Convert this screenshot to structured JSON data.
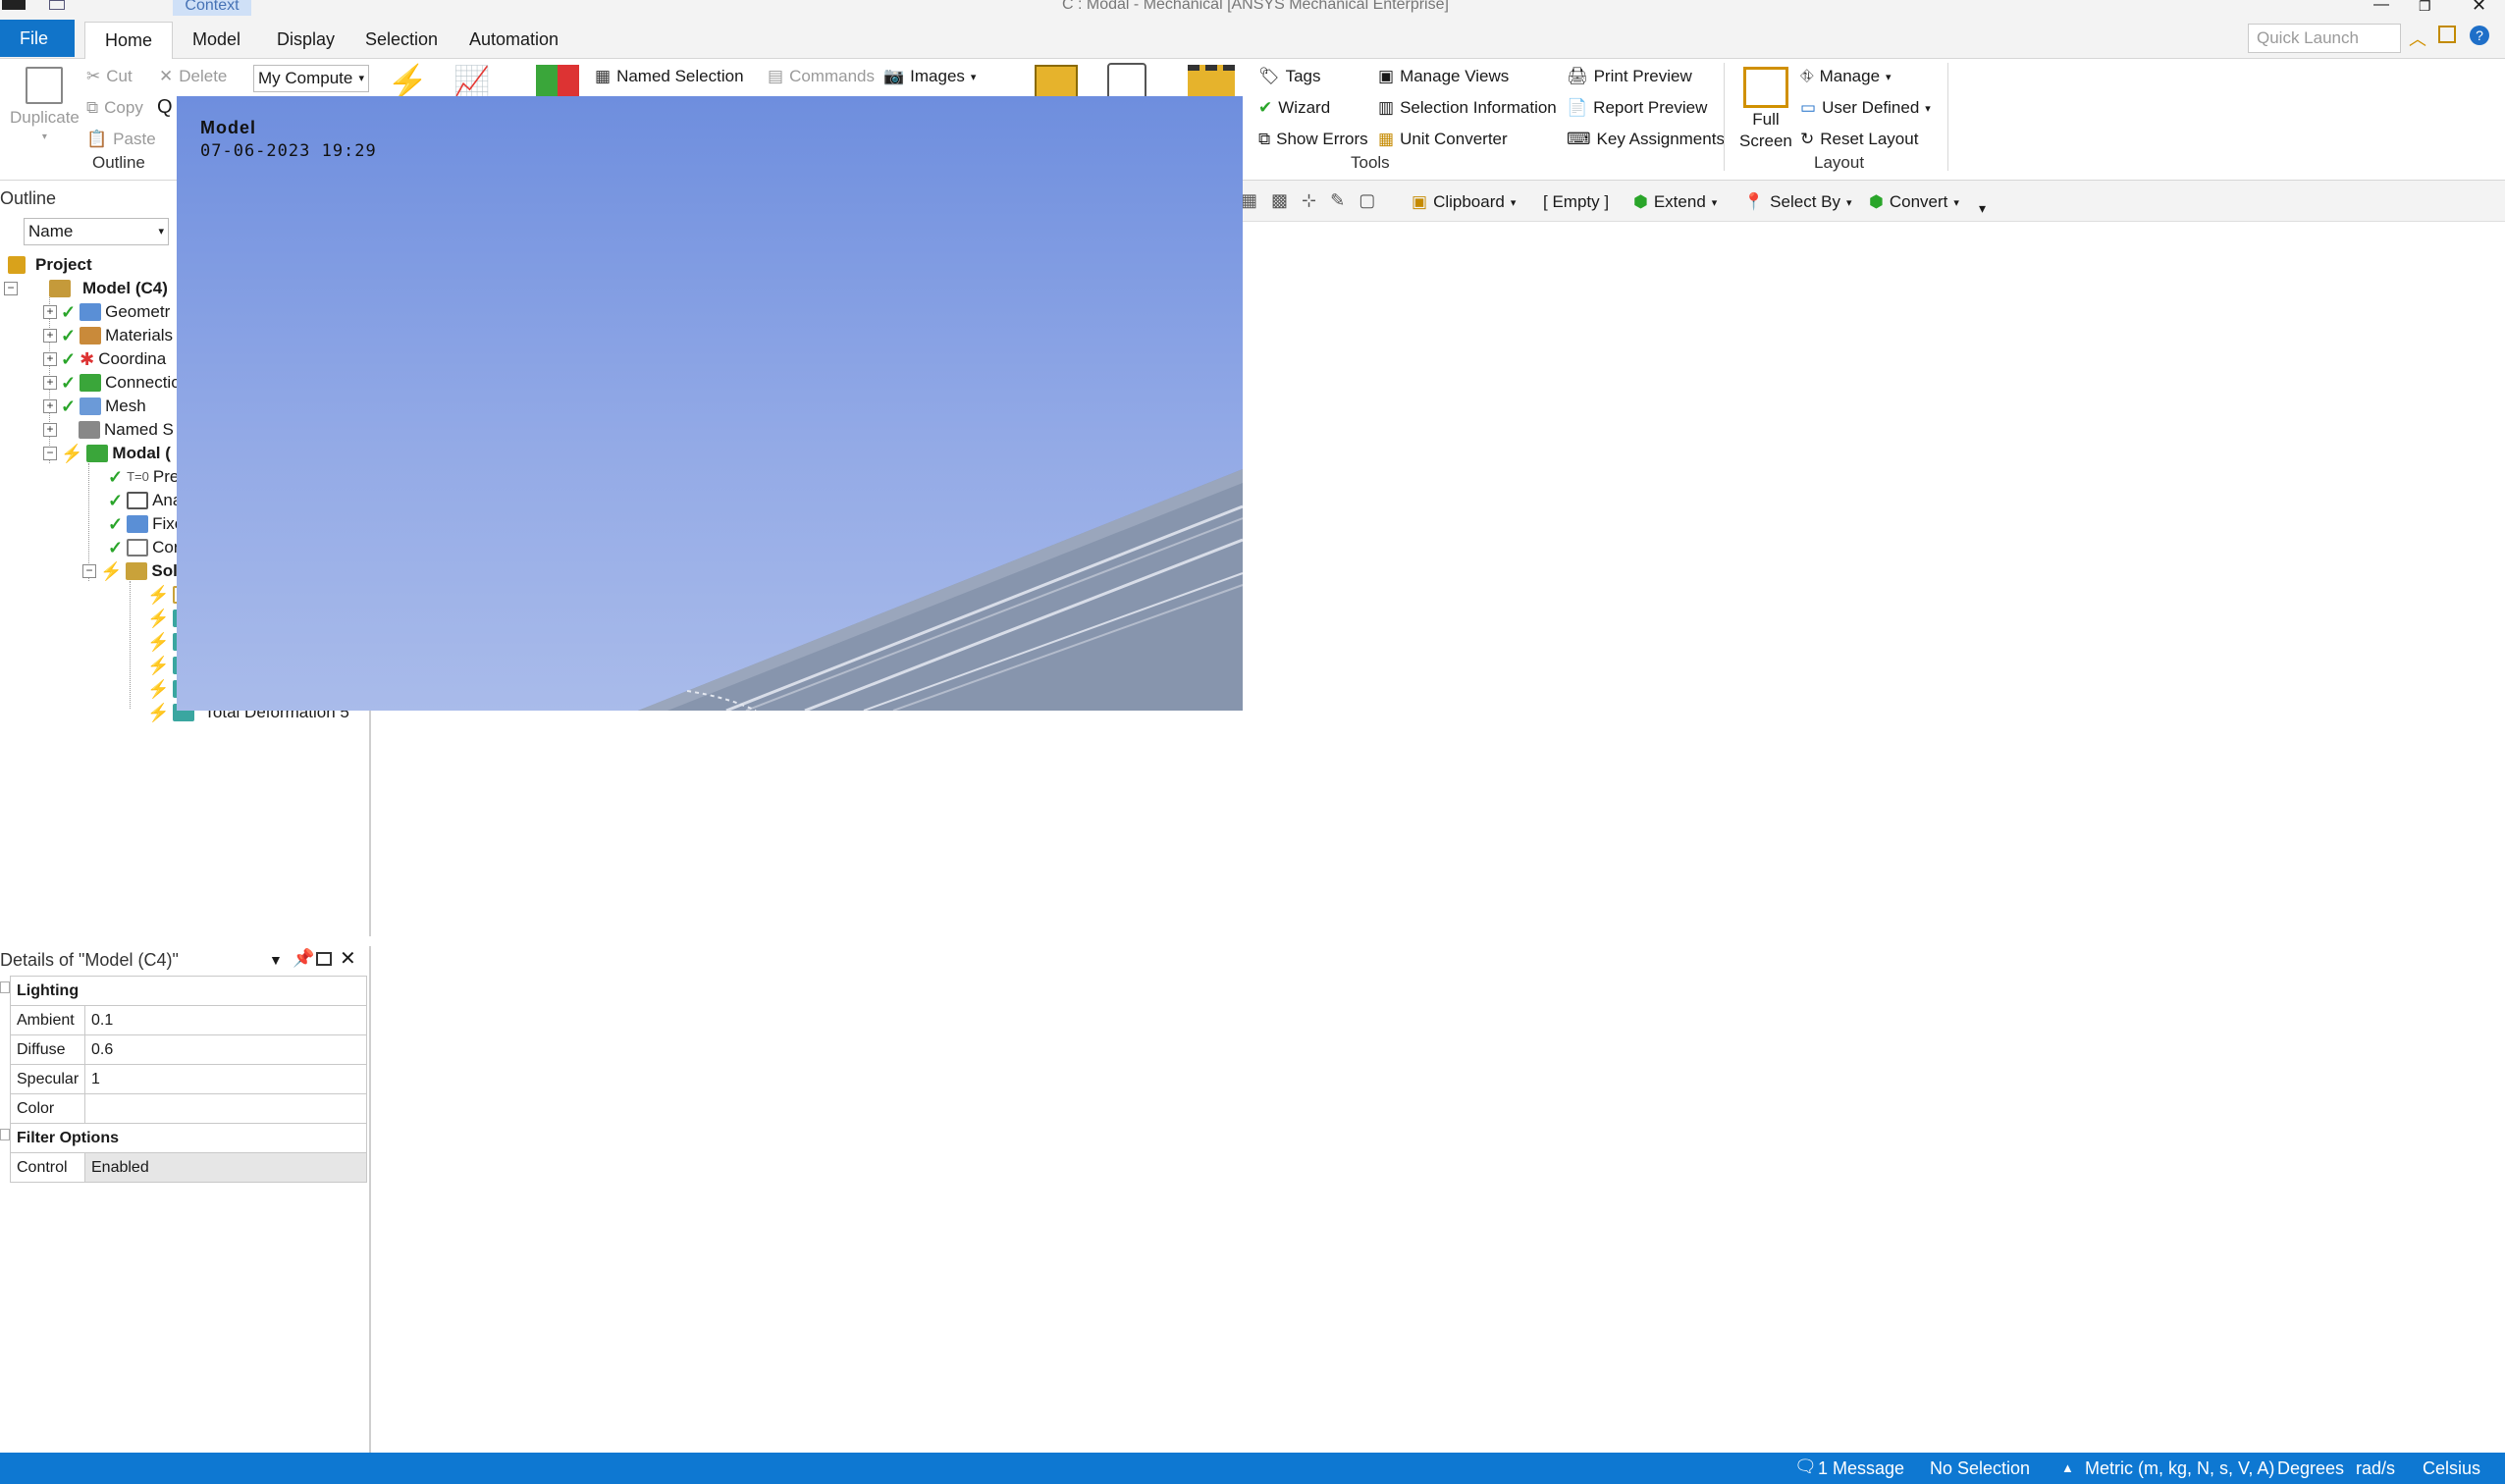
{
  "window": {
    "title": "C : Modal - Mechanical [ANSYS Mechanical Enterprise]",
    "context_tab": "Context"
  },
  "tabs": {
    "file": "File",
    "home": "Home",
    "model": "Model",
    "display": "Display",
    "selection": "Selection",
    "automation": "Automation"
  },
  "quick_launch": {
    "placeholder": "Quick Launch"
  },
  "ribbon": {
    "duplicate": "Duplicate",
    "cut": "Cut",
    "copy": "Copy",
    "paste": "Paste",
    "delete": "Delete",
    "outline_group": "Outline",
    "solver_target": "My Compute",
    "named_selection": "Named Selection",
    "commands": "Commands",
    "images": "Images",
    "tags": "Tags",
    "wizard": "Wizard",
    "show_errors": "Show Errors",
    "manage_views": "Manage Views",
    "selection_information": "Selection Information",
    "unit_converter": "Unit Converter",
    "print_preview": "Print Preview",
    "report_preview": "Report Preview",
    "key_assignments": "Key Assignments",
    "tools_group": "Tools",
    "full_screen_1": "Full",
    "full_screen_2": "Screen",
    "manage": "Manage",
    "user_defined": "User Defined",
    "reset_layout": "Reset Layout",
    "layout_group": "Layout"
  },
  "toolbar2": {
    "clipboard": "Clipboard",
    "empty": "[ Empty ]",
    "extend": "Extend",
    "select_by": "Select By",
    "convert": "Convert"
  },
  "outline": {
    "title": "Outline",
    "filter": "Name",
    "project": "Project",
    "model": "Model (C4)",
    "items": [
      "Geometr",
      "Materials",
      "Coordina",
      "Connectio",
      "Mesh",
      "Named S"
    ],
    "modal": "Modal (",
    "modal_children": [
      "Pre",
      "Ana",
      "Fixe",
      "Cor"
    ],
    "solution": "Sol",
    "last_result": "Total Deformation 5"
  },
  "details": {
    "title": "Details of \"Model (C4)\"",
    "lighting_header": "Lighting",
    "rows": [
      {
        "label": "Ambient",
        "value": "0.1"
      },
      {
        "label": "Diffuse",
        "value": "0.6"
      },
      {
        "label": "Specular",
        "value": "1"
      },
      {
        "label": "Color",
        "value": ""
      }
    ],
    "filter_header": "Filter Options",
    "control_label": "Control",
    "control_value": "Enabled"
  },
  "viewport": {
    "title": "Model",
    "timestamp": "07-06-2023 19:29"
  },
  "status": {
    "messages": "1 Message",
    "selection": "No Selection",
    "units": "Metric (m, kg, N, s, V, A)",
    "angle": "Degrees",
    "rate": "rad/s",
    "temp": "Celsius"
  },
  "colors": {
    "accent": "#1174c9",
    "status_bar": "#0e78d2",
    "viewport_top": "#6e8ede",
    "viewport_bottom": "#a9bbea"
  }
}
